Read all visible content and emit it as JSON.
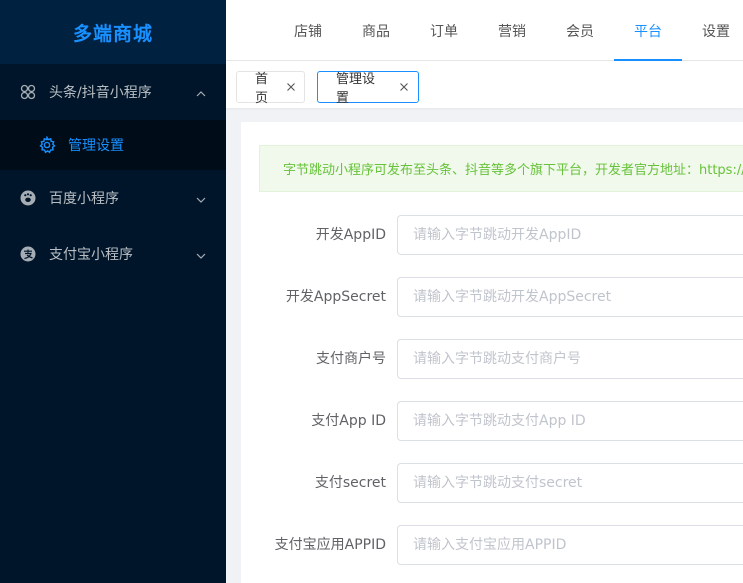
{
  "app": {
    "title": "多端商城"
  },
  "sidebar": {
    "menus": [
      {
        "label": "头条/抖音小程序",
        "icon": "bytedance-icon",
        "expanded": true,
        "children": [
          {
            "label": "管理设置",
            "icon": "gear-icon",
            "active": true
          }
        ]
      },
      {
        "label": "百度小程序",
        "icon": "baidu-icon",
        "expanded": false
      },
      {
        "label": "支付宝小程序",
        "icon": "alipay-icon",
        "expanded": false
      }
    ]
  },
  "topnav": {
    "items": [
      "店铺",
      "商品",
      "订单",
      "营销",
      "会员",
      "平台",
      "设置"
    ],
    "active": "平台"
  },
  "tabs": [
    {
      "label": "首页",
      "active": false
    },
    {
      "label": "管理设置",
      "active": true
    }
  ],
  "alert": {
    "text": "字节跳动小程序可发布至头条、抖音等多个旗下平台，开发者官方地址：https://microapp.bytedance.com"
  },
  "form": {
    "fields": [
      {
        "label": "开发AppID",
        "placeholder": "请输入字节跳动开发AppID",
        "value": ""
      },
      {
        "label": "开发AppSecret",
        "placeholder": "请输入字节跳动开发AppSecret",
        "value": ""
      },
      {
        "label": "支付商户号",
        "placeholder": "请输入字节跳动支付商户号",
        "value": ""
      },
      {
        "label": "支付App ID",
        "placeholder": "请输入字节跳动支付App ID",
        "value": ""
      },
      {
        "label": "支付secret",
        "placeholder": "请输入字节跳动支付secret",
        "value": ""
      },
      {
        "label": "支付宝应用APPID",
        "placeholder": "请输入支付宝应用APPID",
        "value": ""
      }
    ]
  },
  "colors": {
    "sidebar_bg": "#001529",
    "accent": "#1890ff",
    "alert_text": "#67c23a",
    "alert_bg": "#f0f9eb"
  }
}
